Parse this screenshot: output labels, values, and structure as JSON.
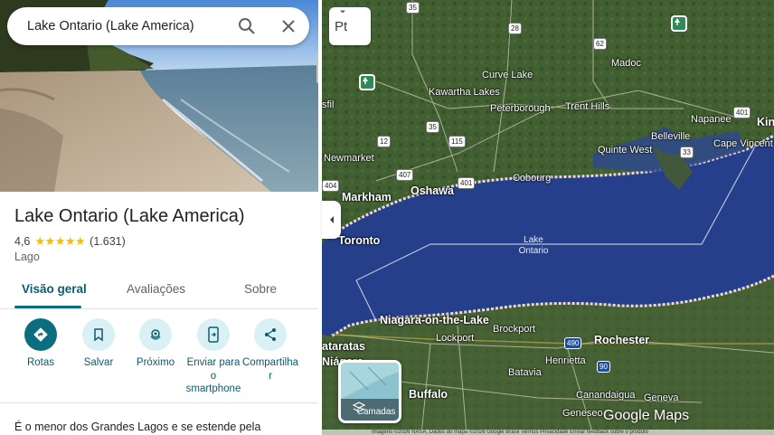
{
  "search": {
    "query": "Lake Ontario (Lake America)"
  },
  "place": {
    "title": "Lake Ontario (Lake America)",
    "rating": "4,6",
    "rating_value": 4.6,
    "stars": "★★★★★",
    "review_count": "(1.631)",
    "type": "Lago"
  },
  "tabs": [
    {
      "label": "Visão geral",
      "active": true
    },
    {
      "label": "Avaliações",
      "active": false
    },
    {
      "label": "Sobre",
      "active": false
    }
  ],
  "actions": [
    {
      "label": "Rotas",
      "icon": "directions-icon"
    },
    {
      "label": "Salvar",
      "icon": "bookmark-icon"
    },
    {
      "label": "Próximo",
      "icon": "nearby-icon"
    },
    {
      "label": "Enviar para o smartphone",
      "icon": "send-to-phone-icon"
    },
    {
      "label": "Compartilhar",
      "icon": "share-icon"
    }
  ],
  "description": "É o menor dos Grandes Lagos e se estende pela",
  "map": {
    "language_button": "Pt",
    "layers_label": "Camadas",
    "logo": "Google Maps",
    "attribution": "Imagens ©2026 NASA, Dados do mapa ©2026 Google   Brasil   Termos   Privacidade   Enviar feedback sobre o produto",
    "lake_label": "Lake Ontario",
    "places": {
      "madoc": "Madoc",
      "curve_lake": "Curve Lake",
      "kawartha_lakes": "Kawartha Lakes",
      "peterborough": "Peterborough",
      "trent_hills": "Trent Hills",
      "belleville": "Belleville",
      "napanee": "Napanee",
      "kingston": "King",
      "quinte_west": "Quinte West",
      "cape_vincent": "Cape Vincent",
      "newmarket": "Newmarket",
      "markham": "Markham",
      "oshawa": "Oshawa",
      "cobourg": "Cobourg",
      "toronto": "Toronto",
      "niagara": "Niagara-on-the-Lake",
      "brockport": "Brockport",
      "lockport": "Lockport",
      "rochester": "Rochester",
      "henrietta": "Henrietta",
      "batavia": "Batavia",
      "buffalo": "Buffalo",
      "canandaigua": "Canandaigua",
      "geneva": "Geneva",
      "geneseo": "Geneseo",
      "cataratas": "ataratas",
      "niagara_falls": "Niágara",
      "sfil": "sfil"
    },
    "shields": {
      "r35a": "35",
      "r28": "28",
      "r62": "62",
      "r35b": "35",
      "r401a": "401",
      "r12": "12",
      "r115": "115",
      "r33": "33",
      "r407": "407",
      "r401b": "401",
      "r404": "404",
      "i490": "490",
      "i90": "90"
    }
  }
}
